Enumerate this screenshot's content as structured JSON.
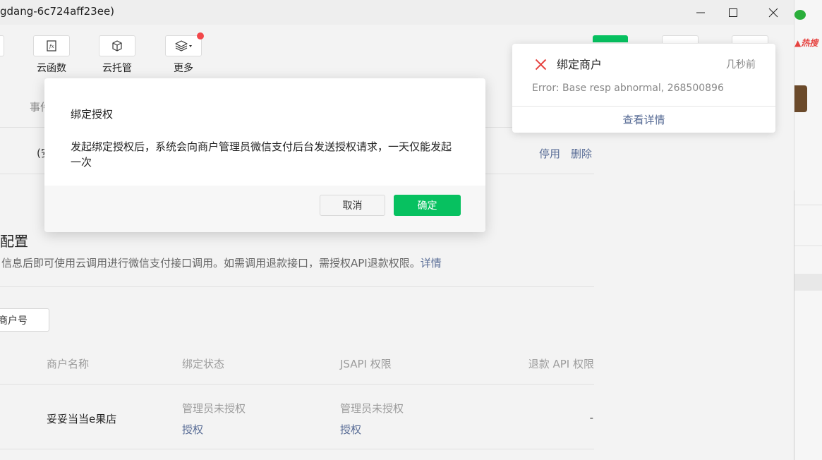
{
  "window": {
    "title": "gdang-6c724aff23ee)"
  },
  "toolbar": {
    "items": [
      {
        "label": "云函数",
        "icon": "function-icon"
      },
      {
        "label": "云托管",
        "icon": "cube-icon"
      },
      {
        "label": "更多",
        "icon": "layers-icon"
      }
    ]
  },
  "side_strip": {
    "hot_label": "热搜"
  },
  "page": {
    "tab_partial": "事件",
    "row_partial": "(安",
    "row_actions": {
      "disable": "停用",
      "delete": "删除"
    },
    "section_title": "配置",
    "section_desc": "信息后即可使用云调用进行微信支付接口调用。如需调用退款接口，需授权API退款权限。",
    "section_desc_link": "详情",
    "add_button": "商户号",
    "table": {
      "headers": [
        "商户名称",
        "绑定状态",
        "JSAPI 权限",
        "退款 API 权限"
      ],
      "rows": [
        {
          "name": "妥妥当当e果店",
          "bind_status": "管理员未授权",
          "bind_action": "授权",
          "jsapi_status": "管理员未授权",
          "jsapi_action": "授权",
          "refund": "-"
        }
      ]
    }
  },
  "modal": {
    "title": "绑定授权",
    "body": "发起绑定授权后，系统会向商户管理员微信支付后台发送授权请求，一天仅能发起一次",
    "cancel": "取消",
    "confirm": "确定"
  },
  "toast": {
    "title": "绑定商户",
    "time": "几秒前",
    "message": "Error: Base resp abnormal, 268500896",
    "details": "查看详情"
  },
  "colors": {
    "accent": "#07c160",
    "link": "#576b95",
    "error": "#e64340"
  }
}
